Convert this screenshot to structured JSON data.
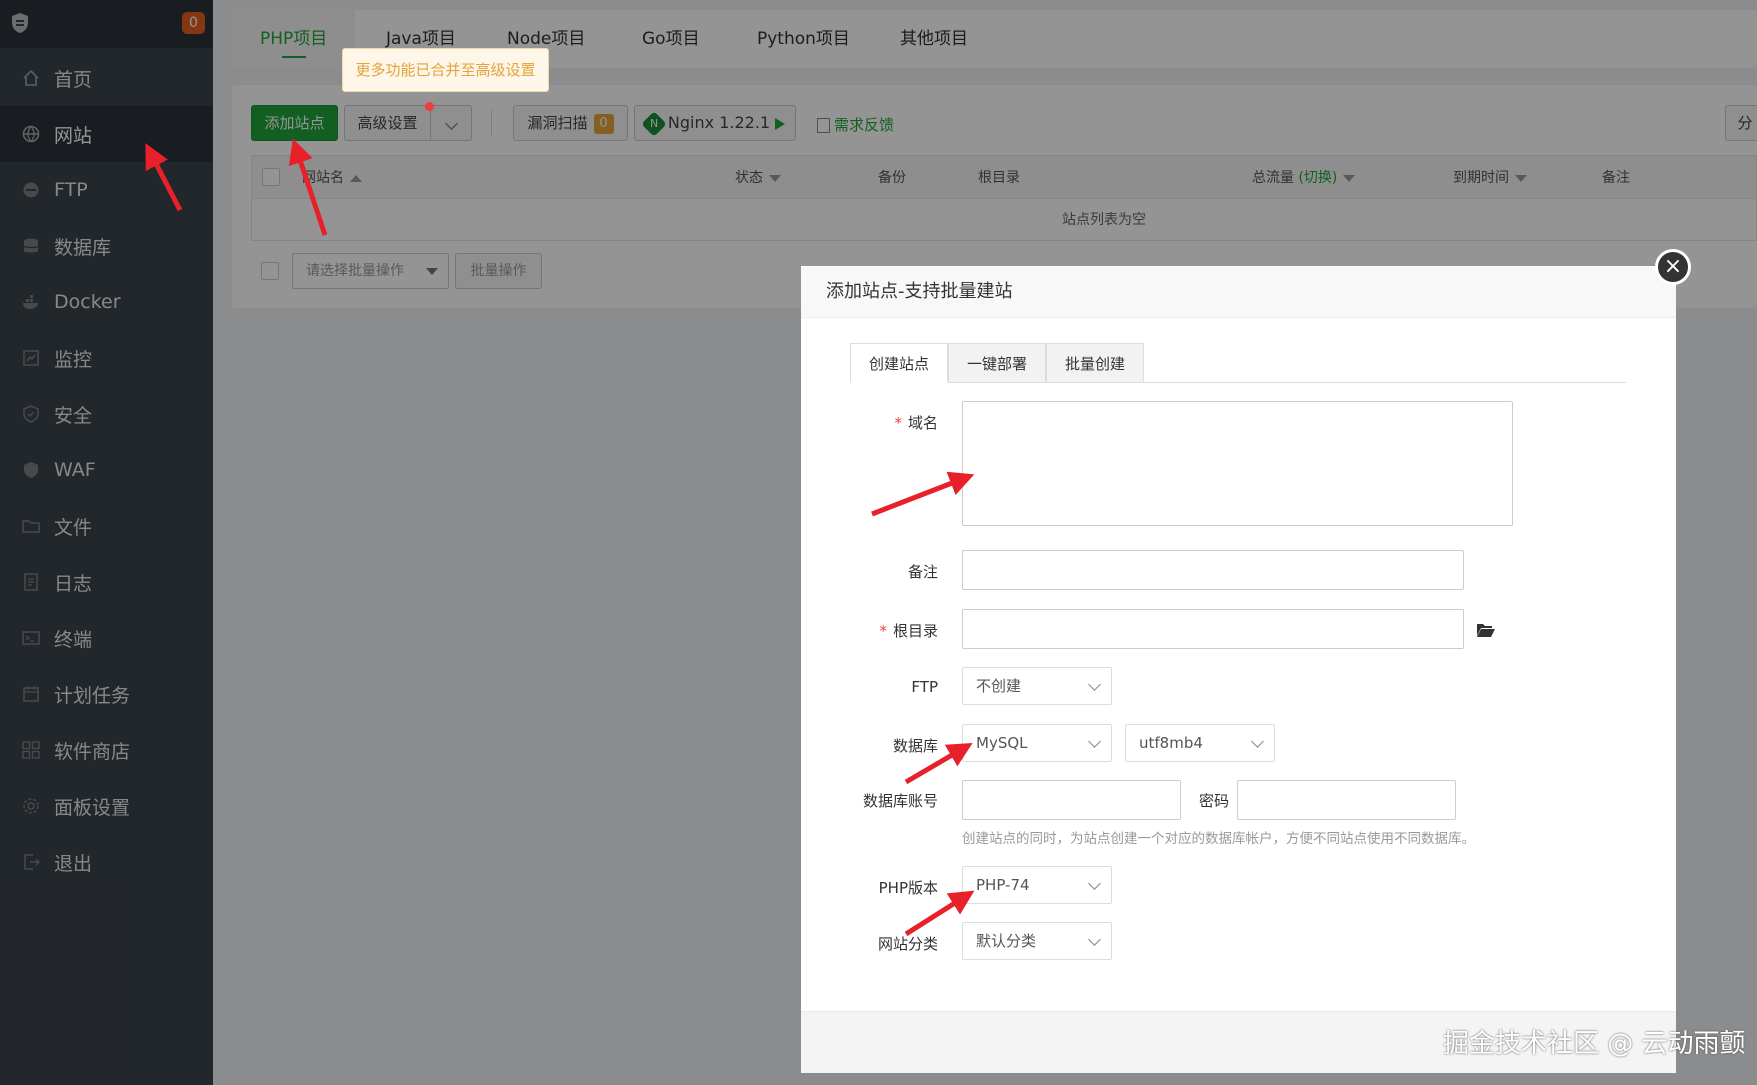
{
  "sidebar": {
    "badge": "0",
    "items": [
      {
        "label": "首页",
        "icon": "home-icon"
      },
      {
        "label": "网站",
        "icon": "globe-icon",
        "active": true
      },
      {
        "label": "FTP",
        "icon": "ftp-icon"
      },
      {
        "label": "数据库",
        "icon": "database-icon"
      },
      {
        "label": "Docker",
        "icon": "docker-icon"
      },
      {
        "label": "监控",
        "icon": "monitor-icon"
      },
      {
        "label": "安全",
        "icon": "shield-icon"
      },
      {
        "label": "WAF",
        "icon": "waf-shield-icon"
      },
      {
        "label": "文件",
        "icon": "folder-icon"
      },
      {
        "label": "日志",
        "icon": "log-icon"
      },
      {
        "label": "终端",
        "icon": "terminal-icon"
      },
      {
        "label": "计划任务",
        "icon": "calendar-icon"
      },
      {
        "label": "软件商店",
        "icon": "apps-icon"
      },
      {
        "label": "面板设置",
        "icon": "gear-icon"
      },
      {
        "label": "退出",
        "icon": "logout-icon"
      }
    ]
  },
  "project_tabs": [
    "PHP项目",
    "Java项目",
    "Node项目",
    "Go项目",
    "Python项目",
    "其他项目"
  ],
  "tooltip": "更多功能已合并至高级设置",
  "toolbar": {
    "add_site": "添加站点",
    "advanced": "高级设置",
    "vuln_scan": "漏洞扫描",
    "vuln_count": "0",
    "nginx": "Nginx 1.22.1",
    "feedback": "需求反馈",
    "right_btn": "分"
  },
  "table": {
    "headers": {
      "name": "网站名",
      "status": "状态",
      "backup": "备份",
      "root": "根目录",
      "traffic": "总流量",
      "traffic_switch": "(切换)",
      "expire": "到期时间",
      "note": "备注"
    },
    "empty": "站点列表为空",
    "batch_placeholder": "请选择批量操作",
    "batch_btn": "批量操作"
  },
  "modal": {
    "title": "添加站点-支持批量建站",
    "tabs": [
      "创建站点",
      "一键部署",
      "批量创建"
    ],
    "labels": {
      "domain": "域名",
      "remark": "备注",
      "root": "根目录",
      "ftp": "FTP",
      "database": "数据库",
      "db_account": "数据库账号",
      "password": "密码",
      "php_version": "PHP版本",
      "site_category": "网站分类"
    },
    "selects": {
      "ftp": "不创建",
      "db_type": "MySQL",
      "charset": "utf8mb4",
      "php": "PHP-74",
      "category": "默认分类"
    },
    "hint": "创建站点的同时，为站点创建一个对应的数据库帐户，方便不同站点使用不同数据库。"
  },
  "watermark": "掘金技术社区 @ 云动雨颤",
  "colors": {
    "accent": "#20a53a",
    "sidebar": "#3c444d",
    "arrow": "#e8202a",
    "badge": "#e6601f"
  }
}
